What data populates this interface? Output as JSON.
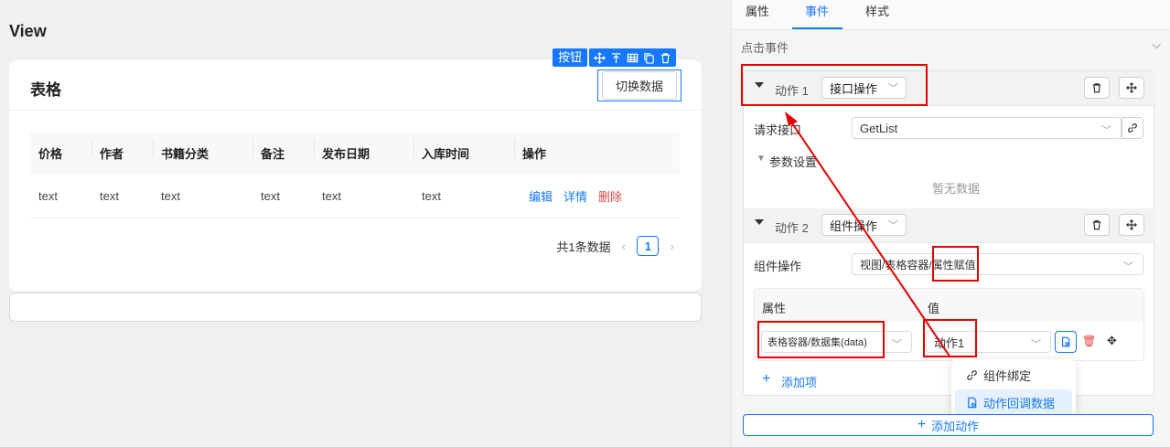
{
  "canvas": {
    "view_title": "View",
    "card_title": "表格",
    "selection_tag": "按钮",
    "switch_button": "切换数据",
    "table": {
      "headers": [
        "价格",
        "作者",
        "书籍分类",
        "备注",
        "发布日期",
        "入库时间",
        "操作"
      ],
      "rows": [
        [
          "text",
          "text",
          "text",
          "text",
          "text",
          "text"
        ]
      ],
      "ops": {
        "edit": "编辑",
        "detail": "详情",
        "delete": "删除"
      }
    },
    "pager": {
      "total": "共1条数据",
      "prev": "‹",
      "page": "1",
      "next": "›"
    }
  },
  "panel": {
    "tabs": [
      "属性",
      "事件",
      "样式"
    ],
    "active_tab": "事件",
    "section_title": "点击事件",
    "action1": {
      "label": "动作 1",
      "type": "接口操作",
      "request_label": "请求接口",
      "request_value": "GetList",
      "params_label": "参数设置",
      "empty_text": "暂无数据"
    },
    "action2": {
      "label": "动作 2",
      "type": "组件操作",
      "op_label": "组件操作",
      "op_value_prefix": "视图/表格容器/",
      "op_value_highlight": "属性赋值",
      "col_attr": "属性",
      "col_value": "值",
      "attr_value": "表格容器/数据集(data)",
      "value_value": "动作1",
      "add_item": "添加项"
    },
    "menu": {
      "item1": "组件绑定",
      "item2": "动作回调数据"
    },
    "add_action": "添加动作"
  },
  "colors": {
    "accent": "#1677ff",
    "danger": "#e60000"
  }
}
